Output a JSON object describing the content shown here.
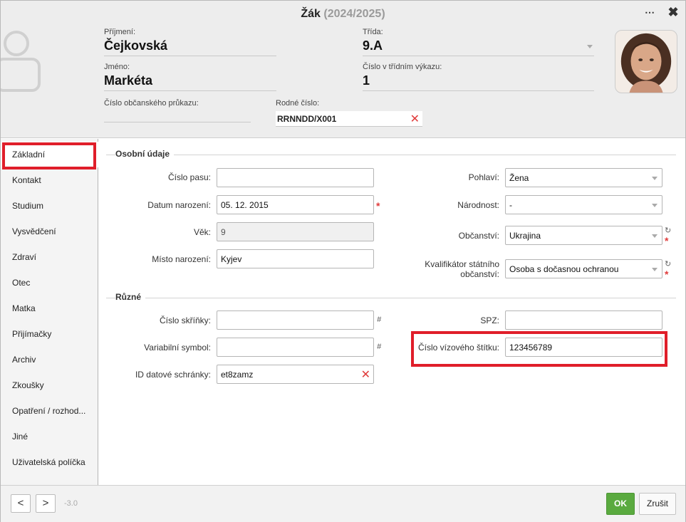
{
  "dialog": {
    "title": "Žák",
    "year": "(2024/2025)"
  },
  "header": {
    "prijmeni_label": "Příjmení:",
    "prijmeni_value": "Čejkovská",
    "jmeno_label": "Jméno:",
    "jmeno_value": "Markéta",
    "trida_label": "Třída:",
    "trida_value": "9.A",
    "cislo_vykaz_label": "Číslo v třídním výkazu:",
    "cislo_vykaz_value": "1",
    "op_label": "Číslo občanského průkazu:",
    "rodne_label": "Rodné číslo:",
    "rodne_value": "RRNNDD/X001",
    "clear_glyph": "✕",
    "menu_glyph": "⋯",
    "close_glyph": "✖"
  },
  "sidebar": {
    "items": [
      {
        "label": "Základní"
      },
      {
        "label": "Kontakt"
      },
      {
        "label": "Studium"
      },
      {
        "label": "Vysvědčení"
      },
      {
        "label": "Zdraví"
      },
      {
        "label": "Otec"
      },
      {
        "label": "Matka"
      },
      {
        "label": "Přijímačky"
      },
      {
        "label": "Archiv"
      },
      {
        "label": "Zkoušky"
      },
      {
        "label": "Opatření / rozhod..."
      },
      {
        "label": "Jiné"
      },
      {
        "label": "Uživatelská políčka"
      }
    ]
  },
  "sections": {
    "osobni": "Osobní údaje",
    "ruzne": "Různé"
  },
  "form": {
    "cislo_pasu_label": "Číslo pasu:",
    "cislo_pasu_value": "",
    "datum_label": "Datum narození:",
    "datum_value": "05. 12. 2015",
    "vek_label": "Věk:",
    "vek_value": "9",
    "misto_label": "Místo narození:",
    "misto_value": "Kyjev",
    "pohlavi_label": "Pohlaví:",
    "pohlavi_value": "Žena",
    "narodnost_label": "Národnost:",
    "narodnost_value": "-",
    "obcanstvi_label": "Občanství:",
    "obcanstvi_value": "Ukrajina",
    "kvalifikator_label_1": "Kvalifikátor státního",
    "kvalifikator_label_2": "občanství:",
    "kvalifikator_value": "Osoba s dočasnou ochranou",
    "skrinka_label": "Číslo skříňky:",
    "skrinka_value": "",
    "variabilni_label": "Variabilní symbol:",
    "variabilni_value": "",
    "datova_label": "ID datové schránky:",
    "datova_value": "et8zamz",
    "spz_label": "SPZ:",
    "spz_value": "",
    "vizovy_label": "Číslo vízového štítku:",
    "vizovy_value": "123456789",
    "required_mark": "*",
    "hash_glyph": "#",
    "refresh_glyph": "↻"
  },
  "footer": {
    "prev": "<",
    "next": ">",
    "version": "-3.0",
    "ok": "OK",
    "cancel": "Zrušit"
  },
  "colors": {
    "highlight": "#e01e2a",
    "ok_green": "#5aaa3f",
    "required_red": "#e03b3b"
  }
}
